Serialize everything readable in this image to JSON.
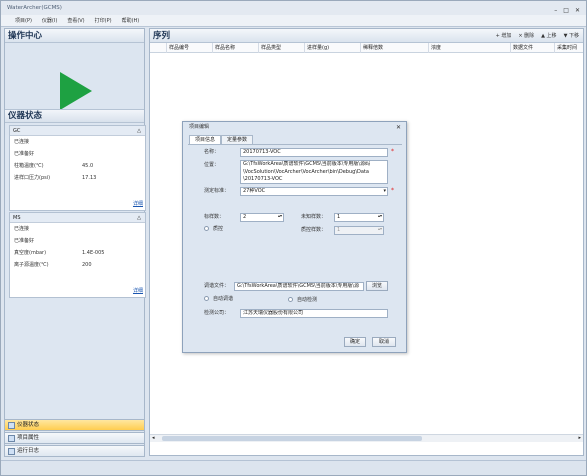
{
  "window": {
    "title": "WaterArcher(GCMS)",
    "min_glyph": "–",
    "max_glyph": "□",
    "close_glyph": "✕"
  },
  "menu": [
    "项目(P)",
    "仪器(I)",
    "查看(V)",
    "打印(P)",
    "帮助(H)"
  ],
  "left": {
    "title": "操作中心",
    "status_title": "仪器状态",
    "gc": {
      "name": "GC",
      "collapse_glyph": "△",
      "rows": [
        {
          "label": "已连接",
          "value": ""
        },
        {
          "label": "已准备好",
          "value": ""
        },
        {
          "label": "柱箱温度(℃)",
          "value": "45.0"
        },
        {
          "label": "进样口压力(psi)",
          "value": "17.13"
        }
      ],
      "details": "详细"
    },
    "ms": {
      "name": "MS",
      "collapse_glyph": "△",
      "rows": [
        {
          "label": "已连接",
          "value": ""
        },
        {
          "label": "已准备好",
          "value": ""
        },
        {
          "label": "真空度(mbar)",
          "value": "1.4E-005"
        },
        {
          "label": "离子源温度(℃)",
          "value": "200"
        }
      ],
      "details": "详细"
    },
    "nav": [
      "仪器状态",
      "项目属性",
      "运行日志"
    ]
  },
  "main": {
    "title": "序列",
    "tools": [
      "+ 增加",
      "× 删除",
      "▲ 上移",
      "▼ 下移"
    ],
    "columns": [
      "样品编号",
      "样品名称",
      "样品类型",
      "进样量(g)",
      "稀释倍数",
      "浓度",
      "数据文件",
      "采集时间"
    ],
    "scroll_left": "◂",
    "scroll_right": "▸"
  },
  "dialog": {
    "title": "项目编辑",
    "close_glyph": "✕",
    "tabs": [
      "项目信息",
      "定量参数"
    ],
    "name_label": "名称：",
    "name_value": "20170713-VOC",
    "location_label": "位置：",
    "location_value_1": "G:\\TfsWorkArea\\质谱软件\\GCMS\\当前版本\\专用版\\源码",
    "location_value_2": "\\VocSolution\\VocArcher\\VocArcher\\bin\\Debug\\Data",
    "location_value_3": "\\20170713-VOC",
    "standard_label": "测定标准：",
    "standard_value": "27种VOC",
    "dropdown_glyph": "▾",
    "spin_glyph": "▴▾",
    "required_glyph": "*",
    "std_count_label": "标样数：",
    "std_count_value": "2",
    "unknown_count_label": "未知样数：",
    "unknown_count_value": "1",
    "parallel_label": "质控",
    "parallel_count_label": "质控样数：",
    "parallel_count_value": "1",
    "tune_label": "调谐文件：",
    "tune_value": "G:\\TfsWorkArea\\质谱软件\\GCMS\\当前版本\\专用版\\源",
    "browse_label": "浏览",
    "auto_tune_label": "自动调谐",
    "auto_check_label": "自动检测",
    "company_label": "检测公司：",
    "company_value": "江苏天瑞仪器股份有限公司",
    "ok_label": "确定",
    "cancel_label": "取消"
  }
}
